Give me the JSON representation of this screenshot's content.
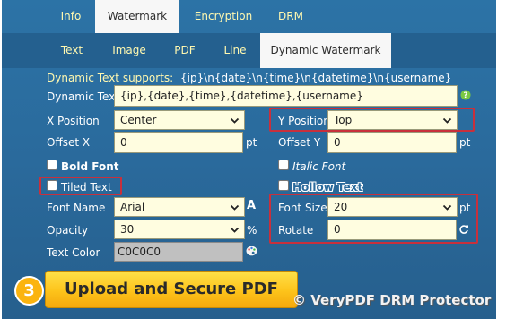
{
  "top_tabs": [
    "Info",
    "Watermark",
    "Encryption",
    "DRM"
  ],
  "sub_tabs": [
    "Text",
    "Image",
    "PDF",
    "Line",
    "Dynamic Watermark"
  ],
  "supports": {
    "label": "Dynamic Text supports:",
    "value": "{ip}\\n{date}\\n{time}\\n{datetime}\\n{username}"
  },
  "form": {
    "dynamic_text_label": "Dynamic Text",
    "dynamic_text_value": "{ip},{date},{time},{datetime},{username}",
    "x_position_label": "X Position",
    "x_position_value": "Center",
    "y_position_label": "Y Position",
    "y_position_value": "Top",
    "offset_x_label": "Offset X",
    "offset_x_value": "0",
    "offset_y_label": "Offset Y",
    "offset_y_value": "0",
    "pt": "pt",
    "bold_font_label": "Bold Font",
    "italic_font_label": "Italic Font",
    "tiled_text_label": "Tiled Text",
    "hollow_text_label": "Hollow Text",
    "font_name_label": "Font Name",
    "font_name_value": "Arial",
    "font_size_label": "Font Size",
    "font_size_value": "20",
    "opacity_label": "Opacity",
    "opacity_value": "30",
    "percent": "%",
    "rotate_label": "Rotate",
    "rotate_value": "0",
    "text_color_label": "Text Color",
    "text_color_value": "C0C0C0"
  },
  "step_number": "3",
  "upload_button": "Upload and Secure PDF",
  "watermark": "© VeryPDF DRM Protector",
  "colors": {
    "panel": "#2a6a9c",
    "tab_text": "#fff8b0",
    "input_bg": "#fffde0",
    "highlight_border": "#c8303c",
    "button": "#fdc31a",
    "text_color_swatch": "#c0c0c0"
  },
  "icons": [
    "help-icon",
    "font-a-icon",
    "palette-icon",
    "rotate-icon",
    "chevron-down-icon"
  ]
}
